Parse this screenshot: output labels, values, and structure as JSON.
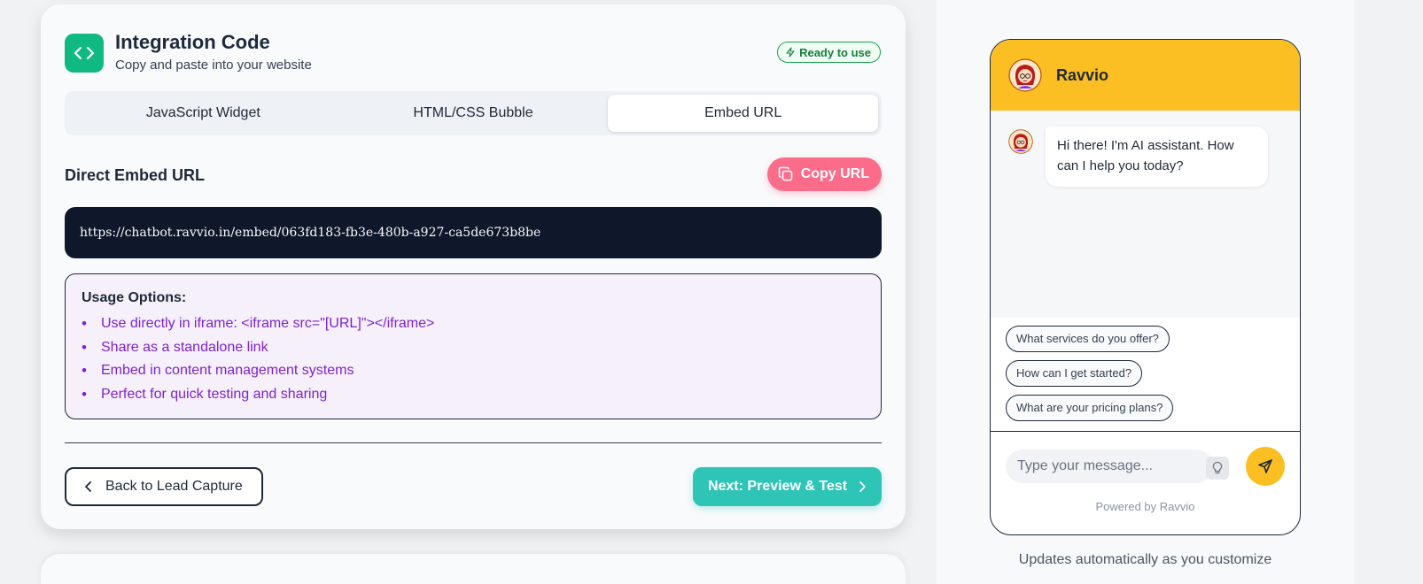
{
  "integration": {
    "title": "Integration Code",
    "subtitle": "Copy and paste into your website",
    "badge": "Ready to use"
  },
  "tabs": [
    {
      "label": "JavaScript Widget",
      "active": false
    },
    {
      "label": "HTML/CSS Bubble",
      "active": false
    },
    {
      "label": "Embed URL",
      "active": true
    }
  ],
  "embed": {
    "section_title": "Direct Embed URL",
    "copy_label": "Copy URL",
    "url": "https://chatbot.ravvio.in/embed/063fd183-fb3e-480b-a927-ca5de673b8be",
    "usage_title": "Usage Options:",
    "usage_options": [
      "Use directly in iframe: <iframe src=\"[URL]\"></iframe>",
      "Share as a standalone link",
      "Embed in content management systems",
      "Perfect for quick testing and sharing"
    ]
  },
  "nav": {
    "back_label": "Back to Lead Capture",
    "next_label": "Next: Preview & Test"
  },
  "preview": {
    "bot_name": "Ravvio",
    "greeting": "Hi there! I'm AI assistant. How can I help you today?",
    "suggestions": [
      "What services do you offer?",
      "How can I get started?",
      "What are your pricing plans?"
    ],
    "input_placeholder": "Type your message...",
    "powered_by": "Powered by Ravvio",
    "caption": "Updates automatically as you customize"
  },
  "colors": {
    "accent_green": "#10b981",
    "copy_pink": "#fb6b8a",
    "next_teal": "#2ec4b6",
    "chat_yellow": "#fbbf24",
    "usage_purple": "#7e22ce",
    "url_bg": "#0f172a"
  },
  "icons": {
    "header": "code-icon",
    "badge": "lightning-icon",
    "copy": "copy-icon",
    "back": "chevron-left-icon",
    "next": "chevron-right-icon",
    "hint": "lightbulb-icon",
    "send": "send-icon",
    "avatar": "avatar-icon"
  }
}
